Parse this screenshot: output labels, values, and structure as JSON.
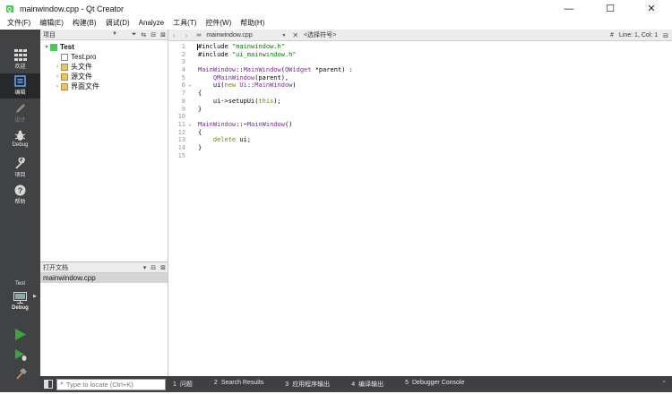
{
  "window": {
    "title": "mainwindow.cpp - Qt Creator",
    "minimize": "—",
    "maximize": "☐",
    "close": "✕"
  },
  "menu": [
    "文件(F)",
    "编辑(E)",
    "构建(B)",
    "调试(D)",
    "Analyze",
    "工具(T)",
    "控件(W)",
    "帮助(H)"
  ],
  "modes": {
    "welcome": "欢迎",
    "edit": "编辑",
    "design": "设计",
    "debug": "Debug",
    "projects": "项目",
    "help": "帮助",
    "kit_project": "Test",
    "kit_config": "Debug"
  },
  "projects_panel": {
    "title": "项目",
    "tree": [
      {
        "label": "Test",
        "level": 0,
        "icon": "project-icon"
      },
      {
        "label": "Test.pro",
        "level": 1,
        "icon": "pro-file-icon"
      },
      {
        "label": "头文件",
        "level": 1,
        "icon": "headers-folder-icon"
      },
      {
        "label": "源文件",
        "level": 1,
        "icon": "sources-folder-icon"
      },
      {
        "label": "界面文件",
        "level": 1,
        "icon": "forms-folder-icon"
      }
    ]
  },
  "open_docs": {
    "title": "打开文档",
    "items": [
      "mainwindow.cpp"
    ]
  },
  "editor": {
    "file": "mainwindow.cpp",
    "symbol": "<选择符号>",
    "position": "Line: 1, Col: 1",
    "hash": "#",
    "lines": [
      {
        "n": "1",
        "fold": "",
        "text": "#include \"mainwindow.h\""
      },
      {
        "n": "2",
        "fold": "",
        "text": "#include \"ui_mainwindow.h\""
      },
      {
        "n": "3",
        "fold": "",
        "text": ""
      },
      {
        "n": "4",
        "fold": "",
        "text": "MainWindow::MainWindow(QWidget *parent) :"
      },
      {
        "n": "5",
        "fold": "",
        "text": "    QMainWindow(parent),"
      },
      {
        "n": "6",
        "fold": "v",
        "text": "    ui(new Ui::MainWindow)"
      },
      {
        "n": "7",
        "fold": "",
        "text": "{"
      },
      {
        "n": "8",
        "fold": "",
        "text": "    ui->setupUi(this);"
      },
      {
        "n": "9",
        "fold": "",
        "text": "}"
      },
      {
        "n": "10",
        "fold": "",
        "text": ""
      },
      {
        "n": "11",
        "fold": "v",
        "text": "MainWindow::~MainWindow()"
      },
      {
        "n": "12",
        "fold": "",
        "text": "{"
      },
      {
        "n": "13",
        "fold": "",
        "text": "    delete ui;"
      },
      {
        "n": "14",
        "fold": "",
        "text": "}"
      },
      {
        "n": "15",
        "fold": "",
        "text": ""
      }
    ]
  },
  "statusbar": {
    "locator_placeholder": "Type to locate (Ctrl+K)",
    "tabs": [
      {
        "n": "1",
        "label": "问题"
      },
      {
        "n": "2",
        "label": "Search Results"
      },
      {
        "n": "3",
        "label": "应用程序输出"
      },
      {
        "n": "4",
        "label": "编译输出"
      },
      {
        "n": "5",
        "label": "Debugger Console"
      }
    ]
  },
  "colors": {
    "modebar": "#404244",
    "modebar_active": "#262829",
    "statusbar": "#3e4043",
    "run_green": "#3fa33f",
    "class_name": "#7a2ca0",
    "string": "#008000",
    "keyword": "#808000"
  }
}
